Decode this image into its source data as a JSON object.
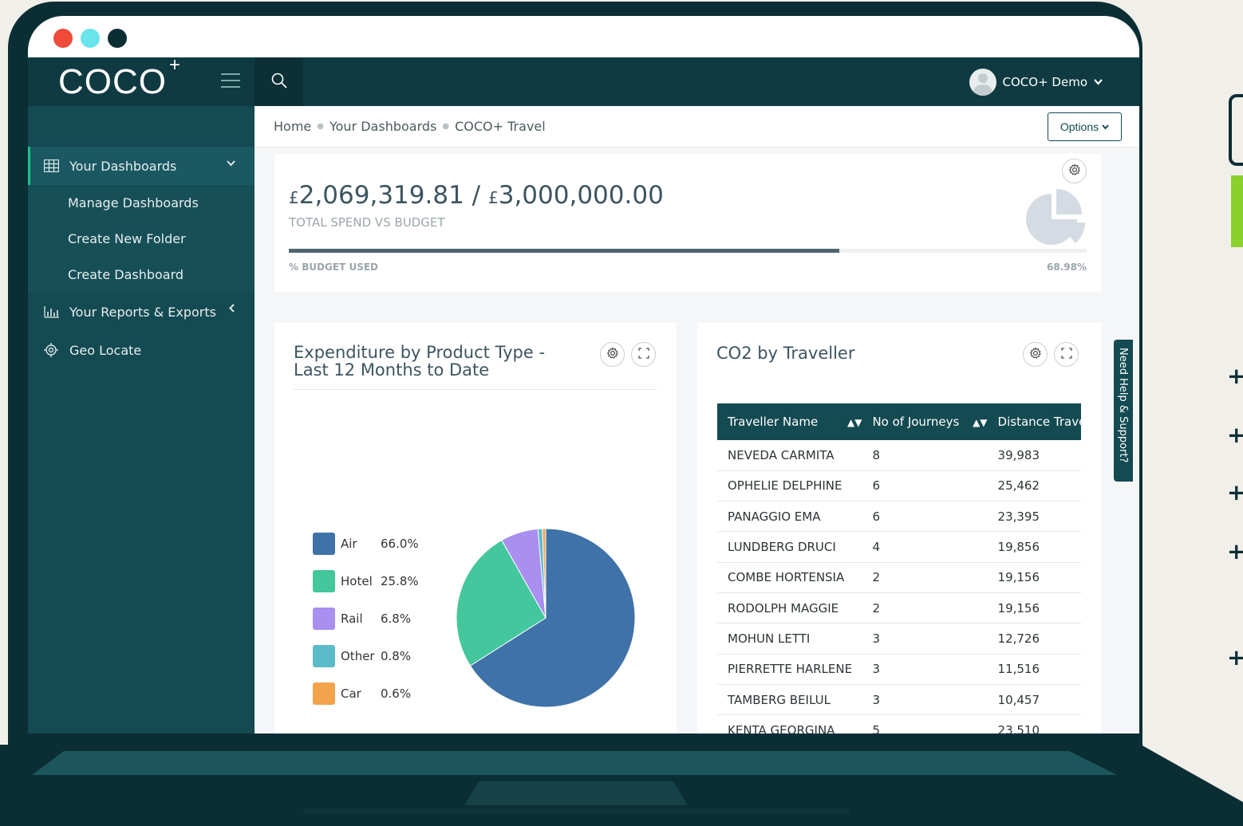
{
  "window": {
    "dot_colors": [
      "#f04a3a",
      "#6ae3ea",
      "#0b2e34"
    ]
  },
  "brand": {
    "name": "COCO",
    "plus": "+"
  },
  "sidebar": {
    "items": [
      {
        "label": "Your Dashboards",
        "icon": "grid-icon"
      },
      {
        "label": "Manage Dashboards"
      },
      {
        "label": "Create New Folder"
      },
      {
        "label": "Create Dashboard"
      },
      {
        "label": "Your Reports & Exports",
        "icon": "bar-chart-icon"
      },
      {
        "label": "Geo Locate",
        "icon": "crosshair-icon"
      }
    ]
  },
  "header": {
    "user_name": "COCO+ Demo"
  },
  "breadcrumb": {
    "home": "Home",
    "dashboards": "Your Dashboards",
    "current": "COCO+ Travel"
  },
  "options_button": "Options",
  "budget": {
    "currency": "£",
    "spend": "2,069,319.81",
    "separator": "/",
    "budget": "3,000,000.00",
    "subtitle": "TOTAL SPEND VS BUDGET",
    "progress_label": "% BUDGET USED",
    "progress_value": "68.98%",
    "progress_fraction": 0.6898
  },
  "expenditure": {
    "title_line1": "Expenditure by Product Type -",
    "title_line2": "Last 12 Months to Date"
  },
  "chart_data": {
    "type": "pie",
    "categories": [
      "Air",
      "Hotel",
      "Rail",
      "Other",
      "Car"
    ],
    "values": [
      66.0,
      25.8,
      6.8,
      0.8,
      0.6
    ],
    "labels": [
      "66.0%",
      "25.8%",
      "6.8%",
      "0.8%",
      "0.6%"
    ],
    "colors": [
      "#3e72a8",
      "#44c79d",
      "#a98ff0",
      "#5bbac7",
      "#f2a44c"
    ],
    "legend": "left"
  },
  "co2": {
    "title": "CO2 by Traveller",
    "columns": [
      "Traveller Name",
      "No of Journeys",
      "Distance Travell"
    ],
    "rows": [
      [
        "NEVEDA CARMITA",
        "8",
        "39,983"
      ],
      [
        "OPHELIE DELPHINE",
        "6",
        "25,462"
      ],
      [
        "PANAGGIO EMA",
        "6",
        "23,395"
      ],
      [
        "LUNDBERG DRUCI",
        "4",
        "19,856"
      ],
      [
        "COMBE HORTENSIA",
        "2",
        "19,156"
      ],
      [
        "RODOLPH MAGGIE",
        "2",
        "19,156"
      ],
      [
        "MOHUN LETTI",
        "3",
        "12,726"
      ],
      [
        "PIERRETTE HARLENE",
        "3",
        "11,516"
      ],
      [
        "TAMBERG BEILUL",
        "3",
        "10,457"
      ],
      [
        "KENTA GEORGINA",
        "5",
        "23,510"
      ]
    ]
  },
  "help_tab": "Need Help & Support?",
  "plus_marks": [
    "+",
    "+",
    "+",
    "+",
    "+"
  ]
}
